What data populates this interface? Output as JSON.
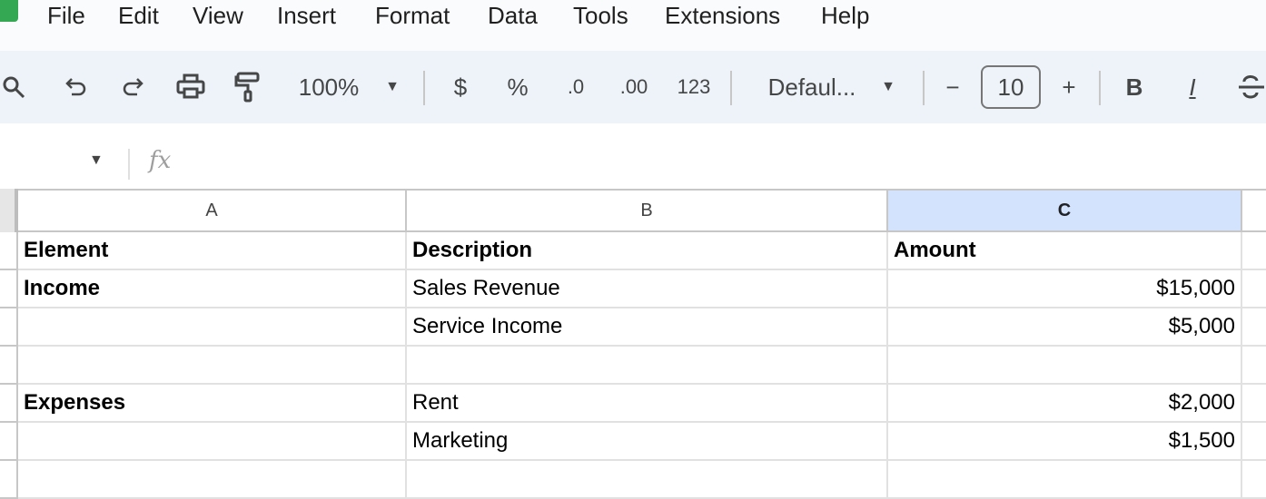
{
  "menu": [
    "File",
    "Edit",
    "View",
    "Insert",
    "Format",
    "Data",
    "Tools",
    "Extensions",
    "Help"
  ],
  "toolbar": {
    "zoom": "100%",
    "currency": "$",
    "percent": "%",
    "decrease_decimal": ".0",
    "increase_decimal": ".00",
    "number_format": "123",
    "font": "Defaul...",
    "font_size": "10",
    "minus": "−",
    "plus": "+",
    "bold": "B",
    "italic": "I"
  },
  "formula_bar": {
    "fx": "fx",
    "value": ""
  },
  "columns": [
    "A",
    "B",
    "C"
  ],
  "selected_column": "C",
  "colors": {
    "selected_header": "#d3e3fd",
    "toolbar_bg": "#eef2f9"
  },
  "rows": [
    {
      "a": "Element",
      "b": "Description",
      "c": "Amount",
      "header": true
    },
    {
      "a": "Income",
      "b": "Sales Revenue",
      "c": "$15,000"
    },
    {
      "a": "",
      "b": "Service Income",
      "c": "$5,000"
    },
    {
      "a": "",
      "b": "",
      "c": ""
    },
    {
      "a": "Expenses",
      "b": "Rent",
      "c": "$2,000"
    },
    {
      "a": "",
      "b": "Marketing",
      "c": "$1,500"
    },
    {
      "a": "",
      "b": "",
      "c": ""
    }
  ]
}
